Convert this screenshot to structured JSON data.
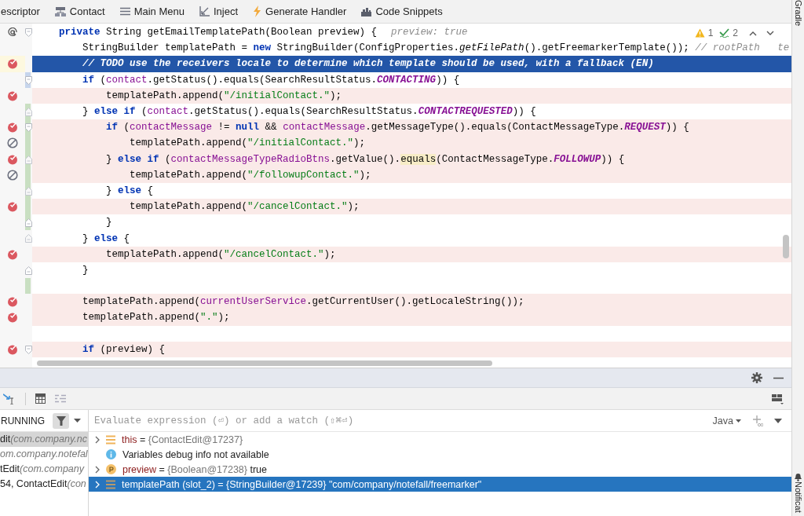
{
  "toolbar": {
    "items": [
      {
        "label": "escriptor"
      },
      {
        "label": "Contact"
      },
      {
        "label": "Main Menu"
      },
      {
        "label": "Inject"
      },
      {
        "label": "Generate Handler"
      },
      {
        "label": "Code Snippets"
      }
    ]
  },
  "side_tabs": {
    "top": "Gradle",
    "bottom": "Notificat"
  },
  "editor": {
    "inspections": {
      "warnings": "1",
      "weak_warnings": "2"
    },
    "lines": [
      {
        "kind": "code",
        "selected": false,
        "fold_start": true,
        "fold_end": false,
        "added": false,
        "modified": false,
        "segments": [
          {
            "kind": "kw",
            "t": "    private"
          },
          {
            "kind": "p",
            "t": " String getEmailTemplatePath(Boolean preview) {"
          }
        ],
        "inlay": "preview: true"
      },
      {
        "kind": "code",
        "selected": false,
        "fold_start": false,
        "fold_end": false,
        "added": false,
        "modified": false,
        "segments": [
          {
            "kind": "p",
            "t": "        StringBuilder templatePath = "
          },
          {
            "kind": "kw",
            "t": "new"
          },
          {
            "kind": "p",
            "t": " StringBuilder(ConfigProperties."
          },
          {
            "kind": "static",
            "t": "getFilePath"
          },
          {
            "kind": "p",
            "t": "().getFreemarkerTemplate()); "
          },
          {
            "kind": "comment",
            "t": "// rootPath   te"
          }
        ]
      },
      {
        "kind": "code",
        "selected": true,
        "breakpoint": {
          "enabled": true
        },
        "fold_start": false,
        "fold_end": false,
        "added": false,
        "modified": false,
        "segments": [
          {
            "kind": "comment",
            "t": "        // TODO use the receivers locale to determine which template should be used, with a fallback (EN)"
          }
        ]
      },
      {
        "kind": "code",
        "selected": false,
        "fold_start": true,
        "fold_end": false,
        "added": false,
        "modified": true,
        "segments": [
          {
            "kind": "kw",
            "t": "        if"
          },
          {
            "kind": "p",
            "t": " ("
          },
          {
            "kind": "field",
            "t": "contact"
          },
          {
            "kind": "p",
            "t": ".getStatus().equals(SearchResultStatus."
          },
          {
            "kind": "const",
            "t": "CONTACTING"
          },
          {
            "kind": "p",
            "t": ")) {"
          }
        ]
      },
      {
        "kind": "code",
        "selected": false,
        "breakpoint": {
          "enabled": true
        },
        "fold_start": false,
        "fold_end": false,
        "added": false,
        "modified": false,
        "segments": [
          {
            "kind": "p",
            "t": "            templatePath.append("
          },
          {
            "kind": "str",
            "t": "\"/initialContact.\""
          },
          {
            "kind": "p",
            "t": ");"
          }
        ]
      },
      {
        "kind": "code",
        "selected": false,
        "fold_start": true,
        "fold_end": true,
        "added": true,
        "modified": false,
        "segments": [
          {
            "kind": "p",
            "t": "        } "
          },
          {
            "kind": "kw",
            "t": "else if"
          },
          {
            "kind": "p",
            "t": " ("
          },
          {
            "kind": "field",
            "t": "contact"
          },
          {
            "kind": "p",
            "t": ".getStatus().equals(SearchResultStatus."
          },
          {
            "kind": "const",
            "t": "CONTACTREQUESTED"
          },
          {
            "kind": "p",
            "t": ")) {"
          }
        ]
      },
      {
        "kind": "code",
        "selected": false,
        "breakpoint": {
          "enabled": true
        },
        "fold_start": true,
        "fold_end": false,
        "added": true,
        "modified": false,
        "segments": [
          {
            "kind": "kw",
            "t": "            if"
          },
          {
            "kind": "p",
            "t": " ("
          },
          {
            "kind": "field",
            "t": "contactMessage"
          },
          {
            "kind": "p",
            "t": " != "
          },
          {
            "kind": "kw",
            "t": "null"
          },
          {
            "kind": "p",
            "t": " && "
          },
          {
            "kind": "field",
            "t": "contactMessage"
          },
          {
            "kind": "p",
            "t": ".getMessageType().equals(ContactMessageType."
          },
          {
            "kind": "const",
            "t": "REQUEST"
          },
          {
            "kind": "p",
            "t": ")) {"
          }
        ]
      },
      {
        "kind": "code",
        "selected": false,
        "breakpoint": {
          "enabled": false
        },
        "fold_start": false,
        "fold_end": false,
        "added": true,
        "modified": false,
        "segments": [
          {
            "kind": "p",
            "t": "                templatePath.append("
          },
          {
            "kind": "str",
            "t": "\"/initialContact.\""
          },
          {
            "kind": "p",
            "t": ");"
          }
        ]
      },
      {
        "kind": "code",
        "selected": false,
        "breakpoint": {
          "enabled": true
        },
        "fold_start": true,
        "fold_end": true,
        "added": true,
        "modified": false,
        "segments": [
          {
            "kind": "p",
            "t": "            } "
          },
          {
            "kind": "kw",
            "t": "else if"
          },
          {
            "kind": "p",
            "t": " ("
          },
          {
            "kind": "field",
            "t": "contactMessageTypeRadioBtns"
          },
          {
            "kind": "p",
            "t": ".getValue()."
          },
          {
            "kind": "match",
            "t": "equals"
          },
          {
            "kind": "p",
            "t": "(ContactMessageType."
          },
          {
            "kind": "const",
            "t": "FOLLOWUP"
          },
          {
            "kind": "p",
            "t": ")) {"
          }
        ]
      },
      {
        "kind": "code",
        "selected": false,
        "breakpoint": {
          "enabled": false
        },
        "fold_start": false,
        "fold_end": false,
        "added": true,
        "modified": false,
        "segments": [
          {
            "kind": "p",
            "t": "                templatePath.append("
          },
          {
            "kind": "str",
            "t": "\"/followupContact.\""
          },
          {
            "kind": "p",
            "t": ");"
          }
        ]
      },
      {
        "kind": "code",
        "selected": false,
        "fold_start": true,
        "fold_end": true,
        "added": true,
        "modified": false,
        "segments": [
          {
            "kind": "p",
            "t": "            } "
          },
          {
            "kind": "kw",
            "t": "else"
          },
          {
            "kind": "p",
            "t": " {"
          }
        ]
      },
      {
        "kind": "code",
        "selected": false,
        "breakpoint": {
          "enabled": true
        },
        "fold_start": false,
        "fold_end": false,
        "added": true,
        "modified": false,
        "segments": [
          {
            "kind": "p",
            "t": "                templatePath.append("
          },
          {
            "kind": "str",
            "t": "\"/cancelContact.\""
          },
          {
            "kind": "p",
            "t": ");"
          }
        ]
      },
      {
        "kind": "code",
        "selected": false,
        "fold_start": false,
        "fold_end": true,
        "added": true,
        "modified": false,
        "segments": [
          {
            "kind": "p",
            "t": "            }"
          }
        ]
      },
      {
        "kind": "code",
        "selected": false,
        "fold_start": true,
        "fold_end": true,
        "added": false,
        "modified": false,
        "segments": [
          {
            "kind": "p",
            "t": "        } "
          },
          {
            "kind": "kw",
            "t": "else"
          },
          {
            "kind": "p",
            "t": " {"
          }
        ]
      },
      {
        "kind": "code",
        "selected": false,
        "breakpoint": {
          "enabled": true
        },
        "fold_start": false,
        "fold_end": false,
        "added": false,
        "modified": false,
        "segments": [
          {
            "kind": "p",
            "t": "            templatePath.append("
          },
          {
            "kind": "str",
            "t": "\"/cancelContact.\""
          },
          {
            "kind": "p",
            "t": ");"
          }
        ]
      },
      {
        "kind": "code",
        "selected": false,
        "fold_start": false,
        "fold_end": true,
        "added": false,
        "modified": false,
        "segments": [
          {
            "kind": "p",
            "t": "        }"
          }
        ]
      },
      {
        "kind": "blank",
        "added": true
      },
      {
        "kind": "code",
        "selected": false,
        "breakpoint": {
          "enabled": true
        },
        "fold_start": false,
        "fold_end": false,
        "added": false,
        "modified": false,
        "segments": [
          {
            "kind": "p",
            "t": "        templatePath.append("
          },
          {
            "kind": "field",
            "t": "currentUserService"
          },
          {
            "kind": "p",
            "t": ".getCurrentUser().getLocaleString());"
          }
        ]
      },
      {
        "kind": "code",
        "selected": false,
        "breakpoint": {
          "enabled": true
        },
        "fold_start": false,
        "fold_end": false,
        "added": false,
        "modified": false,
        "segments": [
          {
            "kind": "p",
            "t": "        templatePath.append("
          },
          {
            "kind": "str",
            "t": "\".\""
          },
          {
            "kind": "p",
            "t": ");"
          }
        ]
      },
      {
        "kind": "blank"
      },
      {
        "kind": "code",
        "selected": false,
        "breakpoint": {
          "enabled": true
        },
        "fold_start": true,
        "fold_end": false,
        "added": false,
        "modified": false,
        "segments": [
          {
            "kind": "kw",
            "t": "        if"
          },
          {
            "kind": "p",
            "t": " (preview) {"
          }
        ]
      }
    ]
  },
  "debugger": {
    "frames": {
      "status": "RUNNING",
      "items": [
        {
          "name": "dit",
          "location": "(com.company.nc",
          "selected": true
        },
        {
          "location": "om.company.notefal",
          "selected": false
        },
        {
          "name": "tEdit",
          "location": "(com.company",
          "selected": false
        },
        {
          "name": "54, ContactEdit",
          "location": "(con",
          "selected": false
        }
      ]
    },
    "evaluate": {
      "placeholder": "Evaluate expression (⏎) or add a watch (⇧⌘⏎)",
      "language": "Java"
    },
    "variables": [
      {
        "kind": "object",
        "name": "this",
        "sep": "=",
        "ref": "{ContactEdit@17237}",
        "expandable": true,
        "selected": false
      },
      {
        "kind": "info",
        "text": "Variables debug info not available",
        "expandable": false,
        "selected": false
      },
      {
        "kind": "param",
        "name": "preview",
        "sep": "=",
        "ref": "{Boolean@17238}",
        "value": "true",
        "expandable": true,
        "selected": false
      },
      {
        "kind": "local",
        "name": "templatePath (slot_2)",
        "sep": "=",
        "ref": "{StringBuilder@17239}",
        "value": "\"com/company/notefall/freemarker\"",
        "expandable": true,
        "selected": true
      }
    ]
  }
}
